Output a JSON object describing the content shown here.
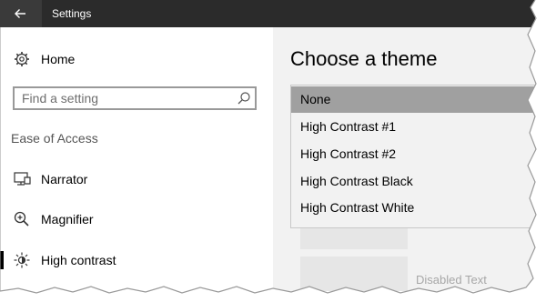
{
  "window": {
    "title": "Settings",
    "back_icon": "back-arrow-icon",
    "titlebar_color": "#2b2b2b"
  },
  "sidebar": {
    "home_label": "Home",
    "home_icon": "gear-icon",
    "search": {
      "placeholder": "Find a setting",
      "value": "",
      "icon": "search-icon"
    },
    "section_label": "Ease of Access",
    "items": [
      {
        "label": "Narrator",
        "icon": "narrator-icon"
      },
      {
        "label": "Magnifier",
        "icon": "magnifier-icon"
      },
      {
        "label": "High contrast",
        "icon": "high-contrast-icon",
        "selected": true
      }
    ]
  },
  "main": {
    "heading": "Choose a theme",
    "theme_options": [
      {
        "label": "None",
        "selected": true
      },
      {
        "label": "High Contrast #1"
      },
      {
        "label": "High Contrast #2"
      },
      {
        "label": "High Contrast Black"
      },
      {
        "label": "High Contrast White"
      }
    ],
    "background_text": {
      "disabled_text": "Disabled Text"
    }
  }
}
